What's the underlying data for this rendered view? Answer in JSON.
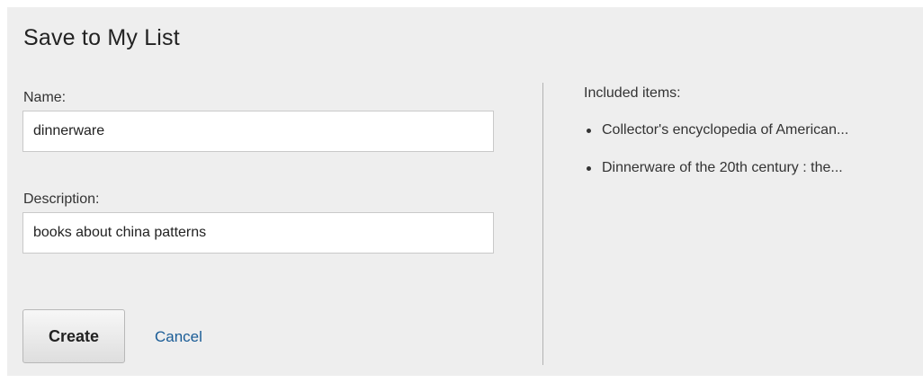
{
  "dialog": {
    "title": "Save to My List"
  },
  "form": {
    "name_label": "Name:",
    "name_value": "dinnerware",
    "description_label": "Description:",
    "description_value": "books about china patterns"
  },
  "actions": {
    "create_label": "Create",
    "cancel_label": "Cancel"
  },
  "included": {
    "label": "Included items:",
    "items": [
      {
        "label": "Collector's encyclopedia of American..."
      },
      {
        "label": "Dinnerware of the 20th century : the..."
      }
    ]
  },
  "colors": {
    "panel_background": "#eeeeee",
    "link": "#1a5c96",
    "divider": "#b3b3b3"
  }
}
